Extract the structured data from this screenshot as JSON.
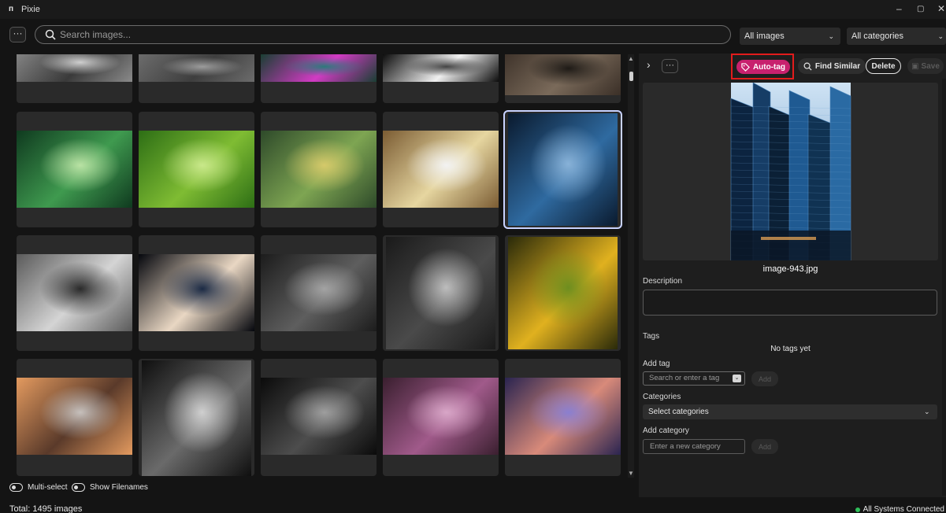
{
  "app": {
    "logo": "п",
    "title": "Pixie",
    "controls": {
      "minimize": "–",
      "maximize": "▢",
      "close": "✕"
    }
  },
  "toolbar": {
    "more": "···",
    "search_placeholder": "Search images...",
    "filter_images": "All images",
    "filter_categories": "All categories"
  },
  "grid": {
    "tiles": [
      {
        "row": 0,
        "col": 0,
        "colors": [
          "#8a8a8a",
          "#3a3a3a",
          "#cfcfcf"
        ],
        "kind": "bw-building"
      },
      {
        "row": 0,
        "col": 1,
        "colors": [
          "#6c6c6c",
          "#3e3e3e",
          "#9c9c9c"
        ],
        "kind": "bw-animals"
      },
      {
        "row": 0,
        "col": 2,
        "colors": [
          "#1a3f33",
          "#d23bc4",
          "#2c7a7a"
        ],
        "kind": "bubbles"
      },
      {
        "row": 0,
        "col": 3,
        "colors": [
          "#0d0d0d",
          "#f0f0f0",
          "#444"
        ],
        "kind": "piano"
      },
      {
        "row": 0,
        "col": 4,
        "colors": [
          "#3a2f27",
          "#7a6a5a",
          "#1e1a16"
        ],
        "kind": "chair"
      },
      {
        "row": 1,
        "col": 0,
        "colors": [
          "#0f3a1f",
          "#3f9a4f",
          "#b9e2a4"
        ],
        "kind": "monstera"
      },
      {
        "row": 1,
        "col": 1,
        "colors": [
          "#2d6e15",
          "#7fbc33",
          "#c9e88a"
        ],
        "kind": "leaf-drop"
      },
      {
        "row": 1,
        "col": 2,
        "colors": [
          "#2e4a2a",
          "#7ea552",
          "#d5c96a"
        ],
        "kind": "bird"
      },
      {
        "row": 1,
        "col": 3,
        "colors": [
          "#7b5c33",
          "#e6d6a0",
          "#f2f2f2"
        ],
        "kind": "dog"
      },
      {
        "row": 1,
        "col": 4,
        "colors": [
          "#0a1a2e",
          "#2f6aa0",
          "#88b2d8"
        ],
        "kind": "city"
      },
      {
        "row": 2,
        "col": 0,
        "colors": [
          "#5a5a5a",
          "#d4d4d4",
          "#2a2a2a"
        ],
        "kind": "bw-kids"
      },
      {
        "row": 2,
        "col": 1,
        "colors": [
          "#05070d",
          "#e9d7c3",
          "#1b2a44"
        ],
        "kind": "swans"
      },
      {
        "row": 2,
        "col": 2,
        "colors": [
          "#1c1c1c",
          "#5e5e5e",
          "#a3a3a3"
        ],
        "kind": "bw-field"
      },
      {
        "row": 2,
        "col": 3,
        "colors": [
          "#1a1a1a",
          "#4a4a4a",
          "#bdbdbd"
        ],
        "kind": "bw-woman"
      },
      {
        "row": 2,
        "col": 4,
        "colors": [
          "#2a2a0a",
          "#e0b11f",
          "#6e8e1f"
        ],
        "kind": "sunflower"
      },
      {
        "row": 3,
        "col": 0,
        "colors": [
          "#e39a5f",
          "#5a3a2a",
          "#c6c0bc"
        ],
        "kind": "mountain"
      },
      {
        "row": 3,
        "col": 1,
        "colors": [
          "#0f0f0f",
          "#6a6a6a",
          "#cfcfcf"
        ],
        "kind": "bw-lantern"
      },
      {
        "row": 3,
        "col": 2,
        "colors": [
          "#0b0b0b",
          "#4d4d4d",
          "#9e9e9e"
        ],
        "kind": "bw-night"
      },
      {
        "row": 3,
        "col": 3,
        "colors": [
          "#3a1f2f",
          "#a05a8a",
          "#d8a6c7"
        ],
        "kind": "succulent"
      },
      {
        "row": 3,
        "col": 4,
        "colors": [
          "#2a2450",
          "#d88a7a",
          "#8a7fd0"
        ],
        "kind": "pier"
      }
    ],
    "selected_index": 9
  },
  "bottom": {
    "multi_select_label": "Multi-select",
    "show_filenames_label": "Show Filenames",
    "total": "Total: 1495 images",
    "status": "All Systems Connected"
  },
  "panel": {
    "collapse_icon": "›",
    "more": "···",
    "autotag_label": "Auto-tag",
    "find_similar_label": "Find Similar",
    "delete_label": "Delete",
    "save_label": "Save",
    "filename": "image-943.jpg",
    "description_label": "Description",
    "tags_label": "Tags",
    "no_tags": "No tags yet",
    "add_tag_label": "Add tag",
    "tag_placeholder": "Search or enter a tag",
    "add_label": "Add",
    "categories_label": "Categories",
    "select_categories": "Select categories",
    "add_category_label": "Add category",
    "category_placeholder": "Enter a new category"
  }
}
